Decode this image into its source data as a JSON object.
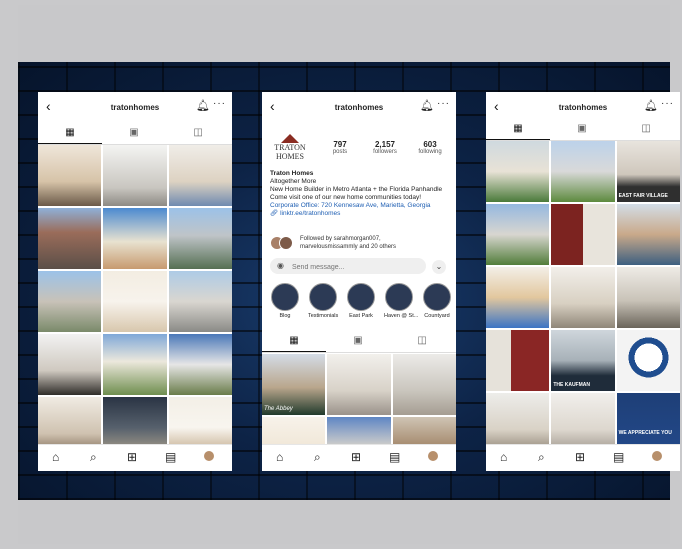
{
  "username": "tratonhomes",
  "profile": {
    "logo_name": "TRATON HOMES",
    "posts": "797",
    "posts_label": "posts",
    "followers": "2,157",
    "followers_label": "followers",
    "following": "603",
    "following_label": "following",
    "bio_name": "Traton Homes",
    "bio_tagline": "Altogether More",
    "bio_desc": "New Home Builder in Metro Atlanta + the Florida Panhandle",
    "bio_cta": "Come visit one of our new home communities today!",
    "bio_address": "Corporate Office: 720 Kennesaw Ave, Marietta, Georgia",
    "bio_link": "linktr.ee/tratonhomes",
    "followed_by": "Followed by sarahmorgan007,",
    "followed_by_2": "marvelousmissammly and 20 others",
    "message_placeholder": "Send message..."
  },
  "highlights": [
    {
      "label": "Blog"
    },
    {
      "label": "Testimonials"
    },
    {
      "label": "East Park"
    },
    {
      "label": "Haven @ St..."
    },
    {
      "label": "Countyard"
    }
  ],
  "icons": {
    "back": "back-arrow-icon",
    "bell": "bell-icon",
    "more": "more-icon",
    "grid": "grid-icon",
    "reels": "reels-icon",
    "tagged": "tagged-icon",
    "home": "home-icon",
    "search": "search-icon",
    "add": "add-icon",
    "shop": "shop-icon",
    "camera": "camera-icon"
  },
  "post_labels": {
    "kaufman": "THE KAUFMAN",
    "east_fair": "EAST FAIR VILLAGE",
    "abbey": "The Abbey",
    "appreciate": "WE APPRECIATE YOU"
  },
  "colors": {
    "accent": "#1f5fb3",
    "brand": "#8a2c22",
    "wall": "#0d2346"
  }
}
